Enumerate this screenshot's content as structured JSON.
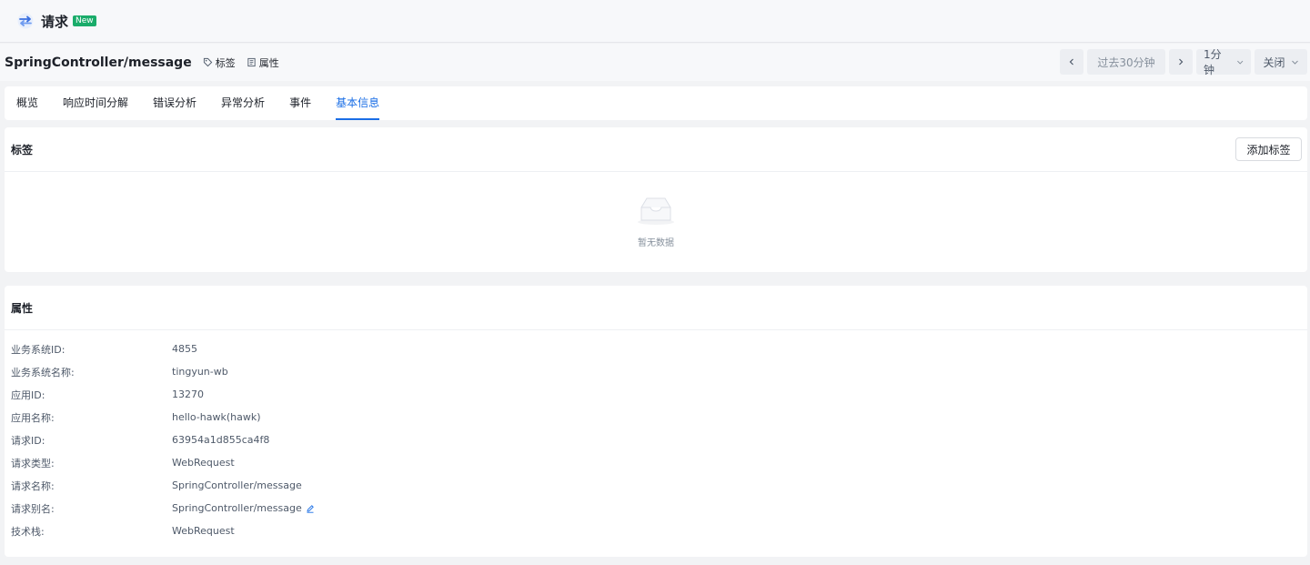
{
  "app": {
    "title": "请求",
    "badge": "New",
    "logo_icon": "request-swap-icon"
  },
  "header": {
    "page_title": "SpringController/message",
    "tags_link": "标签",
    "attrs_link": "属性",
    "time": {
      "prev_icon": "chevron-left-icon",
      "range": "过去30分钟",
      "next_icon": "chevron-right-icon",
      "granularity": "1分钟",
      "close": "关闭"
    }
  },
  "tabs": [
    {
      "label": "概览",
      "active": false
    },
    {
      "label": "响应时间分解",
      "active": false
    },
    {
      "label": "错误分析",
      "active": false
    },
    {
      "label": "异常分析",
      "active": false
    },
    {
      "label": "事件",
      "active": false
    },
    {
      "label": "基本信息",
      "active": true
    }
  ],
  "tags_card": {
    "title": "标签",
    "add_button": "添加标签",
    "empty_text": "暂无数据",
    "empty_icon": "empty-inbox-icon"
  },
  "attrs_card": {
    "title": "属性",
    "rows": [
      {
        "label": "业务系统ID:",
        "value": "4855"
      },
      {
        "label": "业务系统名称:",
        "value": "tingyun-wb"
      },
      {
        "label": "应用ID:",
        "value": "13270"
      },
      {
        "label": "应用名称:",
        "value": "hello-hawk(hawk)"
      },
      {
        "label": "请求ID:",
        "value": "63954a1d855ca4f8"
      },
      {
        "label": "请求类型:",
        "value": "WebRequest"
      },
      {
        "label": "请求名称:",
        "value": "SpringController/message"
      },
      {
        "label": "请求别名:",
        "value": "SpringController/message",
        "editable": true
      },
      {
        "label": "技术栈:",
        "value": "WebRequest"
      }
    ]
  },
  "colors": {
    "accent": "#1a6ee6",
    "badge": "#1aac6a"
  }
}
